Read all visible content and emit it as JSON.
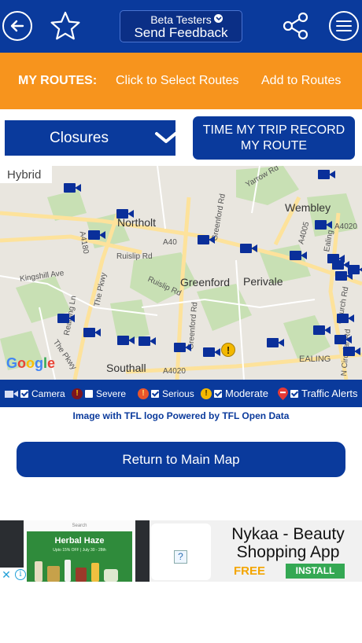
{
  "header": {
    "feedback_line1": "Beta Testers",
    "feedback_line2": "Send Feedback",
    "icons": [
      "back-arrow-icon",
      "star-icon",
      "chevron-down-icon",
      "share-icon",
      "hamburger-menu-icon"
    ]
  },
  "routes_bar": {
    "title": "MY ROUTES:",
    "select_link": "Click to Select Routes",
    "add_link": "Add to Routes"
  },
  "controls": {
    "closures_value": "Closures",
    "record_line1": "TIME MY TRIP RECORD",
    "record_line2": "MY ROUTE"
  },
  "map": {
    "layer_label": "Hybrid",
    "places": [
      "Northolt",
      "Wembley",
      "Greenford",
      "Perivale",
      "Southall",
      "EALING"
    ],
    "roads": [
      "A40",
      "A4180",
      "A4005",
      "A4020",
      "A4020",
      "Kingshill Ave",
      "Ruislip Rd",
      "Ruislip Rd",
      "The Pkwy",
      "The Pkwy",
      "Greenford Rd",
      "Greenford Rd",
      "Yarrow Rd",
      "Ealing",
      "Reading Ln",
      "N Circular Rd",
      "Church Rd"
    ],
    "colors": {
      "camera": "#0a2f9a",
      "alert": "#f3b800",
      "land": "#e9e6df",
      "park": "#c8e0b4",
      "road": "#fde29b"
    }
  },
  "legend": {
    "camera": "Camera",
    "severe": "Severe",
    "serious": "Serious",
    "moderate": "Moderate",
    "traffic_alerts": "Traffic Alerts",
    "checked": {
      "camera": true,
      "severe": false,
      "serious": true,
      "moderate": true,
      "traffic_alerts": true
    }
  },
  "tfl_note": "Image with TFL logo Powered by TFL Open Data",
  "return_button": "Return to Main Map",
  "ad": {
    "search_text": "Search",
    "banner_headline": "Herbal Haze",
    "banner_offer": "Upto 15% OFF | July 30 - 28th",
    "title": "Nykaa - Beauty Shopping App",
    "price": "FREE",
    "install": "INSTALL",
    "placeholder_icon": "?"
  },
  "brand": {
    "primary": "#0a3a9c",
    "orange": "#f7941d"
  }
}
